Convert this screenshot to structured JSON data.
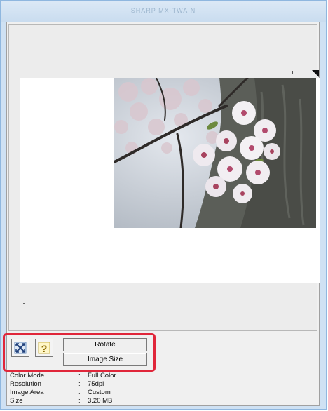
{
  "window": {
    "title": "SHARP MX-TWAIN"
  },
  "toolbar": {
    "icons": [
      "select-all-icon",
      "help-icon"
    ],
    "rotate_label": "Rotate",
    "image_size_label": "Image Size"
  },
  "info": {
    "rows": [
      {
        "label": "Color Mode",
        "sep": ":",
        "value": "Full Color"
      },
      {
        "label": "Resolution",
        "sep": ":",
        "value": "75dpi"
      },
      {
        "label": "Image Area",
        "sep": ":",
        "value": "Custom"
      },
      {
        "label": "Size",
        "sep": ":",
        "value": "3.20 MB"
      }
    ]
  },
  "colors": {
    "window_frame": "#cfe1f3",
    "highlight": "#e0263a",
    "background": "#f0f0f0"
  }
}
